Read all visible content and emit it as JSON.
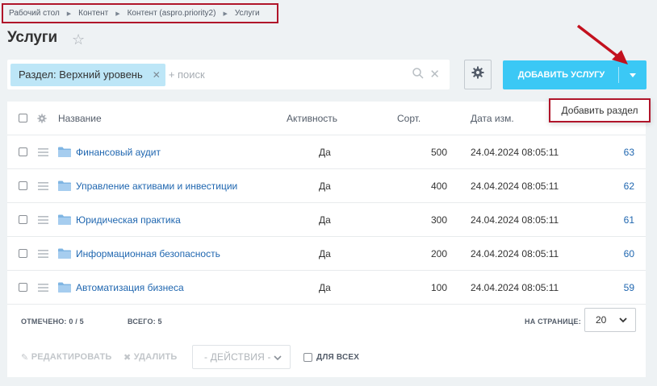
{
  "breadcrumb": [
    "Рабочий стол",
    "Контент",
    "Контент (aspro.priority2)",
    "Услуги"
  ],
  "page_title": "Услуги",
  "filter": {
    "chip_label": "Раздел: Верхний уровень",
    "search_placeholder": "+ поиск"
  },
  "add_button_label": "ДОБАВИТЬ УСЛУГУ",
  "dropdown_item": "Добавить раздел",
  "table": {
    "headers": {
      "name": "Название",
      "active": "Активность",
      "sort": "Сорт.",
      "date": "Дата изм."
    },
    "rows": [
      {
        "name": "Финансовый аудит",
        "active": "Да",
        "sort": "500",
        "date": "24.04.2024 08:05:11",
        "id": "63"
      },
      {
        "name": "Управление активами и инвестиции",
        "active": "Да",
        "sort": "400",
        "date": "24.04.2024 08:05:11",
        "id": "62"
      },
      {
        "name": "Юридическая практика",
        "active": "Да",
        "sort": "300",
        "date": "24.04.2024 08:05:11",
        "id": "61"
      },
      {
        "name": "Информационная безопасность",
        "active": "Да",
        "sort": "200",
        "date": "24.04.2024 08:05:11",
        "id": "60"
      },
      {
        "name": "Автоматизация бизнеса",
        "active": "Да",
        "sort": "100",
        "date": "24.04.2024 08:05:11",
        "id": "59"
      }
    ]
  },
  "footer": {
    "selected_label": "ОТМЕЧЕНО:",
    "selected_value": "0 / 5",
    "total_label": "ВСЕГО:",
    "total_value": "5",
    "per_page_label": "НА СТРАНИЦЕ:",
    "per_page_value": "20",
    "edit_label": "РЕДАКТИРОВАТЬ",
    "delete_label": "УДАЛИТЬ",
    "actions_label": "- ДЕЙСТВИЯ -",
    "for_all_label": "ДЛЯ ВСЕХ"
  },
  "colors": {
    "accent": "#3bc8f5",
    "highlight_border": "#b0152a",
    "link": "#2067b0",
    "folder": "#7fb5e3"
  }
}
